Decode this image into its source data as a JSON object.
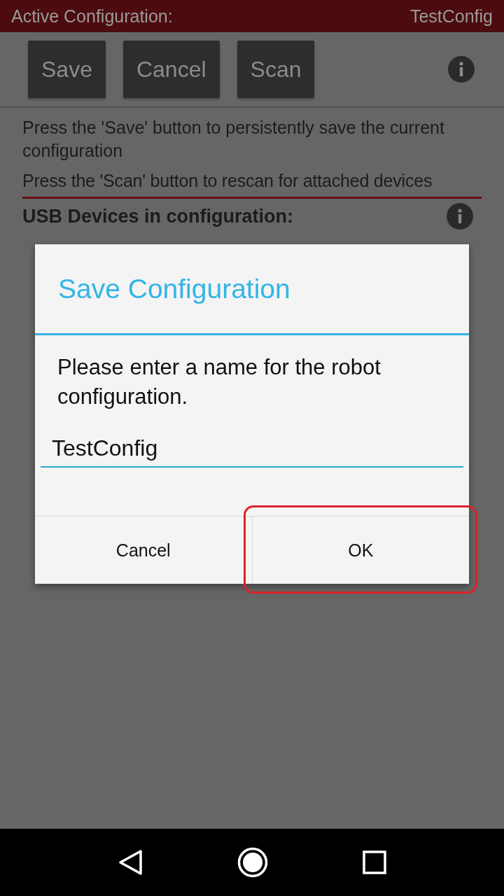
{
  "status_bar": {
    "label": "Active Configuration:",
    "value": "TestConfig"
  },
  "toolbar": {
    "buttons": [
      "Save",
      "Cancel",
      "Scan"
    ]
  },
  "hints": [
    "Press the 'Save' button to persistently save the current configuration",
    "Press the 'Scan' button to rescan for attached devices"
  ],
  "section_title": "USB Devices in configuration:",
  "dialog": {
    "title": "Save Configuration",
    "message": "Please enter a name for the robot configuration.",
    "input_value": "TestConfig",
    "buttons": [
      {
        "label": "Cancel",
        "highlighted": false
      },
      {
        "label": "OK",
        "highlighted": true
      }
    ]
  }
}
